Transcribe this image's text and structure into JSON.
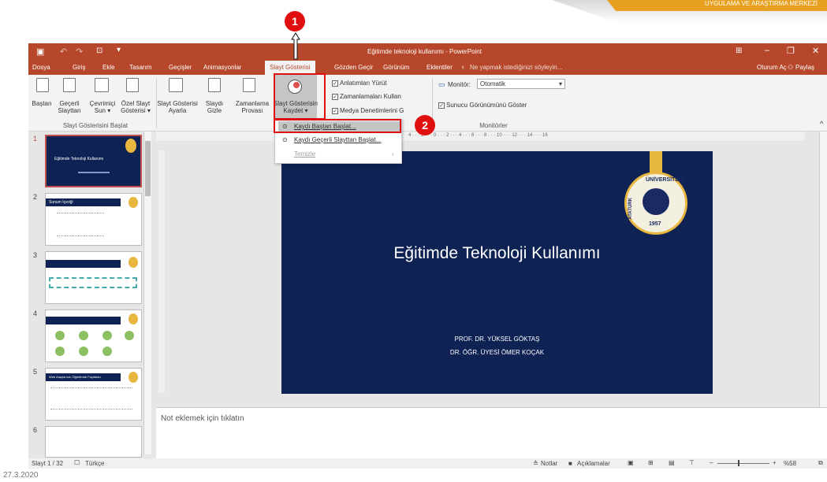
{
  "banner": {
    "text": "UYGULAMA VE ARAŞTIRMA MERKEZİ"
  },
  "callouts": [
    "1",
    "2"
  ],
  "window": {
    "title": "Eğitimde teknoloji kullanımı - PowerPoint"
  },
  "menu": {
    "items": [
      "Dosya",
      "Giriş",
      "Ekle",
      "Tasarım",
      "Geçişler",
      "Animasyonlar",
      "Slayt Gösterisi",
      "Gözden Geçir",
      "Görünüm",
      "Eklentiler"
    ],
    "tell_me": "Ne yapmak istediğinizi söyleyin...",
    "signin": "Oturum Aç",
    "share": "Paylaş"
  },
  "ribbon": {
    "from_beginning": "Baştan",
    "from_current": [
      "Geçerli",
      "Slayttan"
    ],
    "online": [
      "Çevrimiçi",
      "Sun ▾"
    ],
    "custom": [
      "Özel Slayt",
      "Gösterisi ▾"
    ],
    "group1": "Slayt Gösterisini Başlat",
    "setup": [
      "Slayt Gösterisi",
      "Ayarla"
    ],
    "hide": [
      "Slaydı",
      "Gizle"
    ],
    "rehearse": [
      "Zamanlama",
      "Provası"
    ],
    "record": [
      "Slayt Gösterisin",
      "Kaydet ▾"
    ],
    "play_narrations": "Anlatımları Yürüt",
    "use_timings": "Zamanlamaları Kullan",
    "media_controls": "Medya Denetimlerini G",
    "monitor_label": "Monitör:",
    "monitor_value": "Otomatik",
    "presenter_view": "Sunucu Görünümünü Göster",
    "group_monitors": "Monitörler"
  },
  "dropdown": {
    "items": [
      "Kaydı Baştan Başlat...",
      "Kaydı Geçerli Slayttan Başlat...",
      "Temizle"
    ]
  },
  "thumbnails": {
    "numbers": [
      "1",
      "2",
      "3",
      "4",
      "5",
      "6"
    ],
    "t1": "Eğitimde Teknoloji Kullanımı",
    "t2": "Sunum İçeriği",
    "t5": "Web Araçlarının Öğretimde Faydaları"
  },
  "slide": {
    "title": "Eğitimde Teknoloji Kullanımı",
    "author1": "PROF. DR. YÜKSEL GÖKTAŞ",
    "author2": "DR. ÖĞR. ÜYESİ ÖMER KOÇAK",
    "seal_top": "ÜNİVERSİTESİ",
    "seal_left": "ATATÜRK",
    "seal_year": "1957"
  },
  "notes": {
    "placeholder": "Not eklemek için tıklatın"
  },
  "status": {
    "slide": "Slayt 1 / 32",
    "language": "Türkçe",
    "notes": "Notlar",
    "comments": "Açıklamalar",
    "zoom": "%58"
  },
  "date": "27.3.2020",
  "ruler": "4 · · · 2 · · · 0 · · · 2 · · · 4 · · · 6 · · · 8 · · · 10 · · · 12 · · · 14 · · · 16"
}
